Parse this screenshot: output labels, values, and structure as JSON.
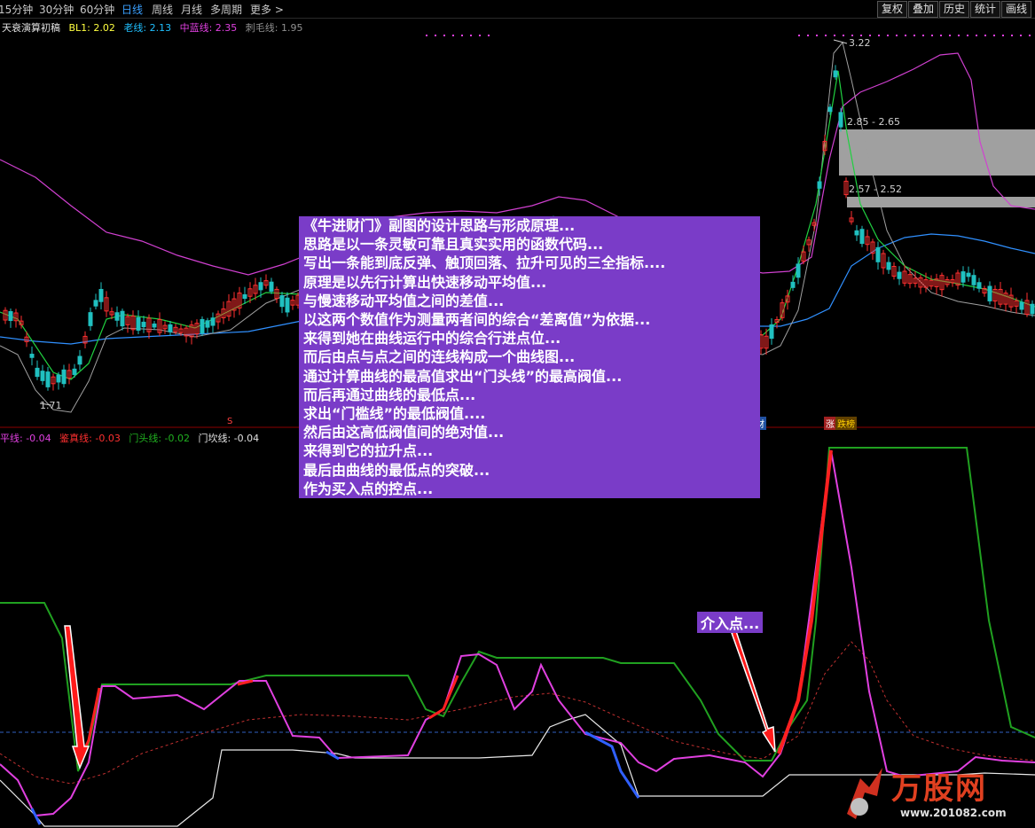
{
  "toolbar": {
    "periods": [
      "15分钟",
      "30分钟",
      "60分钟",
      "日线",
      "周线",
      "月线",
      "多周期",
      "更多"
    ],
    "active": "日线",
    "right_buttons": [
      "复权",
      "叠加",
      "历史",
      "统计",
      "画线"
    ]
  },
  "main_legend": {
    "title": "天衰演算初稿",
    "bl1": "BL1: 2.02",
    "laoxian": "老线: 2.13",
    "zhonglan": "中蓝线: 2.35",
    "cimao": "刺毛线: 1.95"
  },
  "sub_legend": {
    "pingxian": "平线: -0.04",
    "jianzhen": "鉴真线: -0.03",
    "mentou": "门头线: -0.02",
    "menkan": "门坎线: -0.04"
  },
  "price_labels": {
    "high": "3.22",
    "low": "1.71",
    "gap1": "2.85 - 2.65",
    "gap2": "2.57 - 2.52"
  },
  "markers": {
    "s": "S",
    "cai": "财",
    "zhang": "涨",
    "bang": "跌榜"
  },
  "explanation": [
    "《牛进财门》副图的设计思路与形成原理...",
    "思路是以一条灵敏可靠且真实实用的函数代码...",
    "写出一条能到底反弹、触顶回落、拉升可见的三全指标....",
    "原理是以先行计算出快速移动平均值...",
    "与慢速移动平均值之间的差值...",
    "以这两个数值作为测量两者间的综合“差离值”为依据...",
    "来得到她在曲线运行中的综合行进点位...",
    "而后由点与点之间的连线构成一个曲线图...",
    "通过计算曲线的最高值求出“门头线”的最高阀值...",
    "而后再通过曲线的最低点...",
    "求出“门槛线”的最低阀值....",
    "然后由这高低阀值间的绝对值...",
    "来得到它的拉升点...",
    "最后由曲线的最低点的突破...",
    "作为买入点的控点..."
  ],
  "annotation": "介入点...",
  "watermark": {
    "name": "万股网",
    "url": "www.201082.com"
  },
  "colors": {
    "active_tab": "#3aa0ff",
    "overlay_bg": "#7a3cc8",
    "up": "#ff3030",
    "down": "#20c0c0",
    "magenta": "#e040e0",
    "green": "#20a020",
    "blue": "#3070ff"
  }
}
